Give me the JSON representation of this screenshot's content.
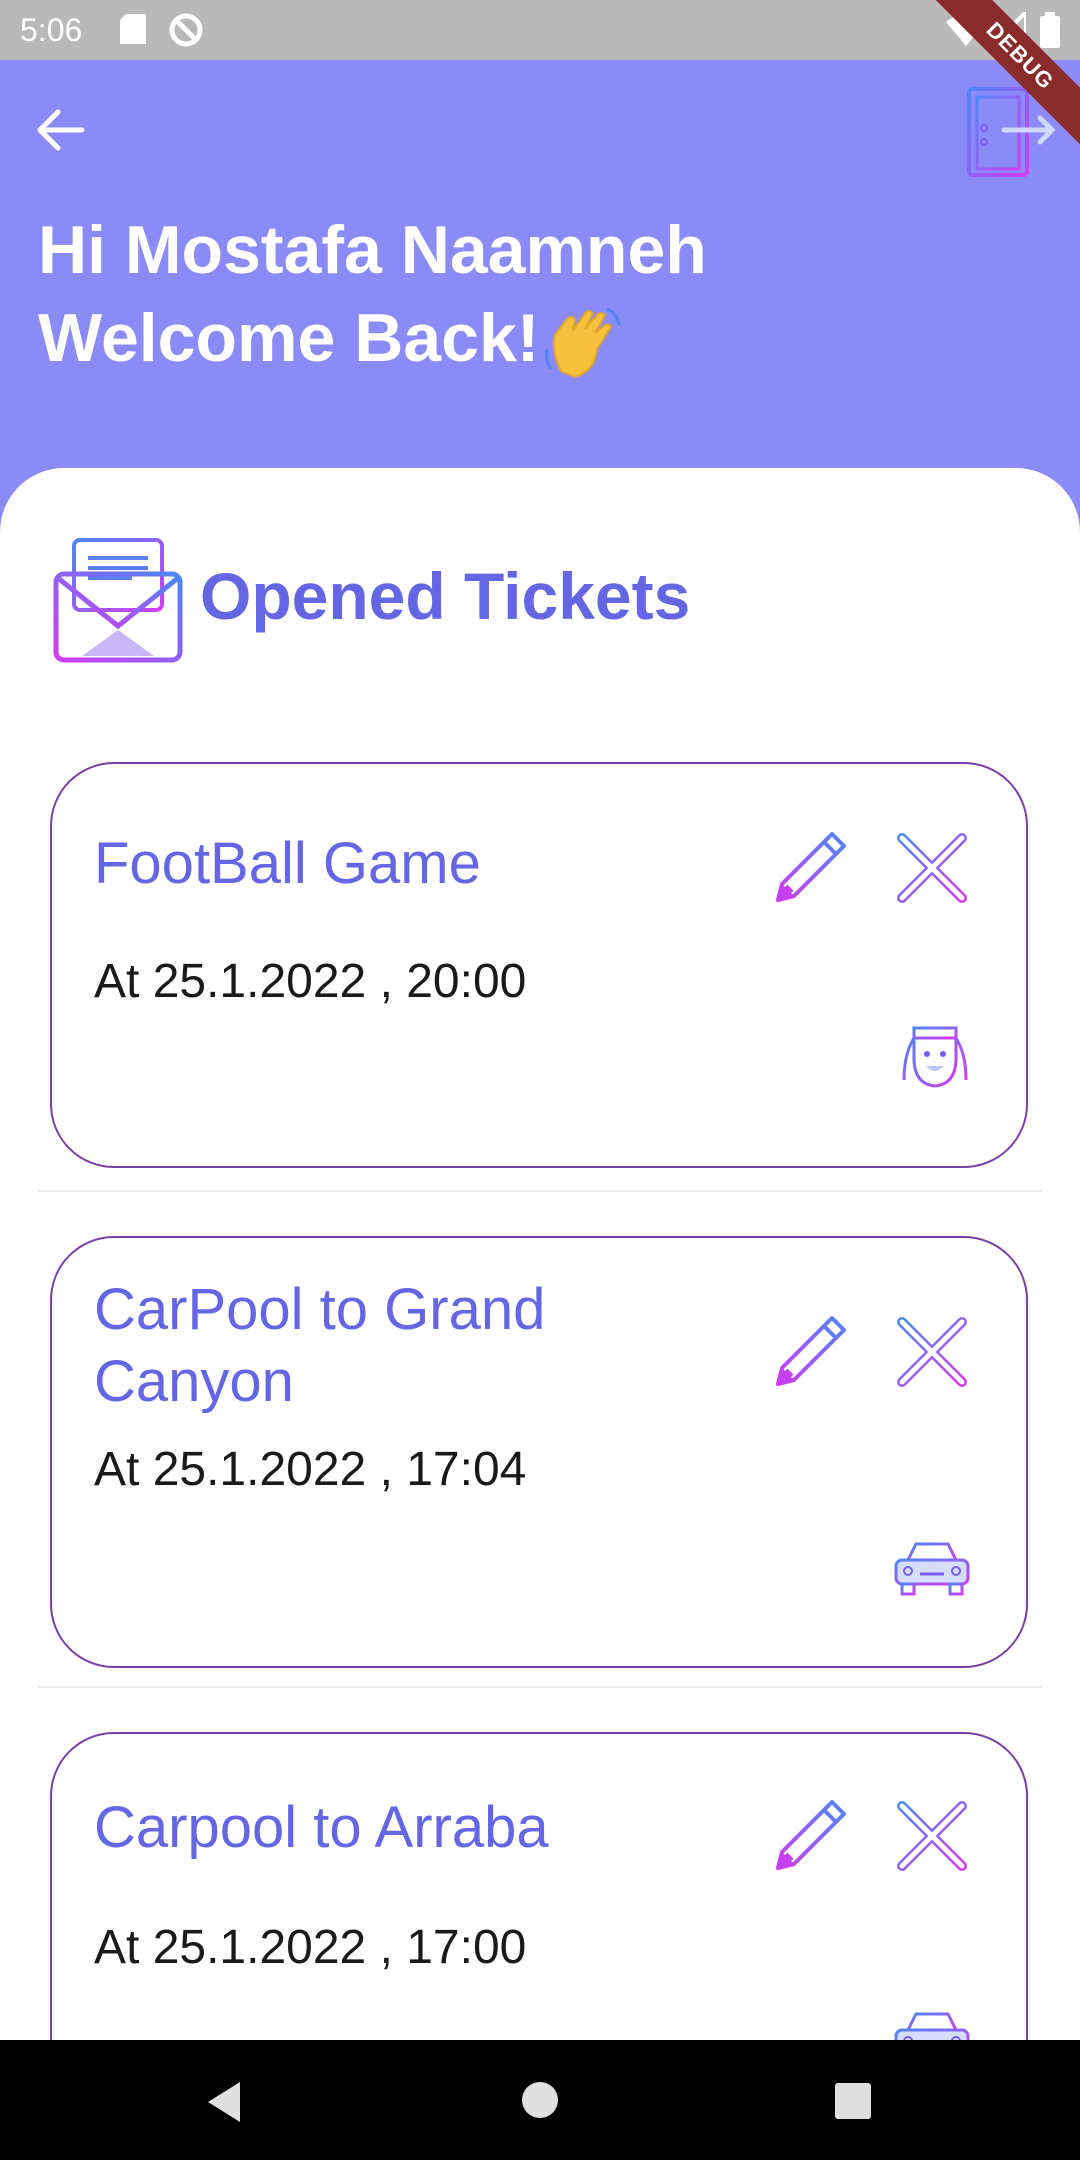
{
  "status_bar": {
    "time": "5:06",
    "icons": [
      "sd-card-icon",
      "sync-icon",
      "wifi-icon",
      "signal-icon",
      "battery-icon"
    ]
  },
  "debug_banner": "DEBUG",
  "header": {
    "back_icon": "arrow-left-icon",
    "logout_icon": "door-exit-icon",
    "greeting_line1": "Hi Mostafa Naamneh",
    "greeting_line2": "Welcome Back!",
    "wave_icon": "waving-hand-icon"
  },
  "section": {
    "icon": "envelope-icon",
    "title": "Opened Tickets"
  },
  "tickets": [
    {
      "title": "FootBall Game",
      "date": "At 25.1.2022 , 20:00",
      "type_icon": "person-icon"
    },
    {
      "title": "CarPool to Grand Canyon",
      "date": "At 25.1.2022 , 17:04",
      "type_icon": "car-icon"
    },
    {
      "title": "Carpool to Arraba",
      "date": "At 25.1.2022 , 17:00",
      "type_icon": "car-icon"
    }
  ],
  "colors": {
    "header_bg": "#8b8bf7",
    "accent": "#6466e3",
    "card_border": "#7b3fa8",
    "gradient_start": "#5b7df6",
    "gradient_end": "#c43ff2"
  },
  "nav_bar": [
    "nav-back-icon",
    "nav-home-icon",
    "nav-recents-icon"
  ]
}
